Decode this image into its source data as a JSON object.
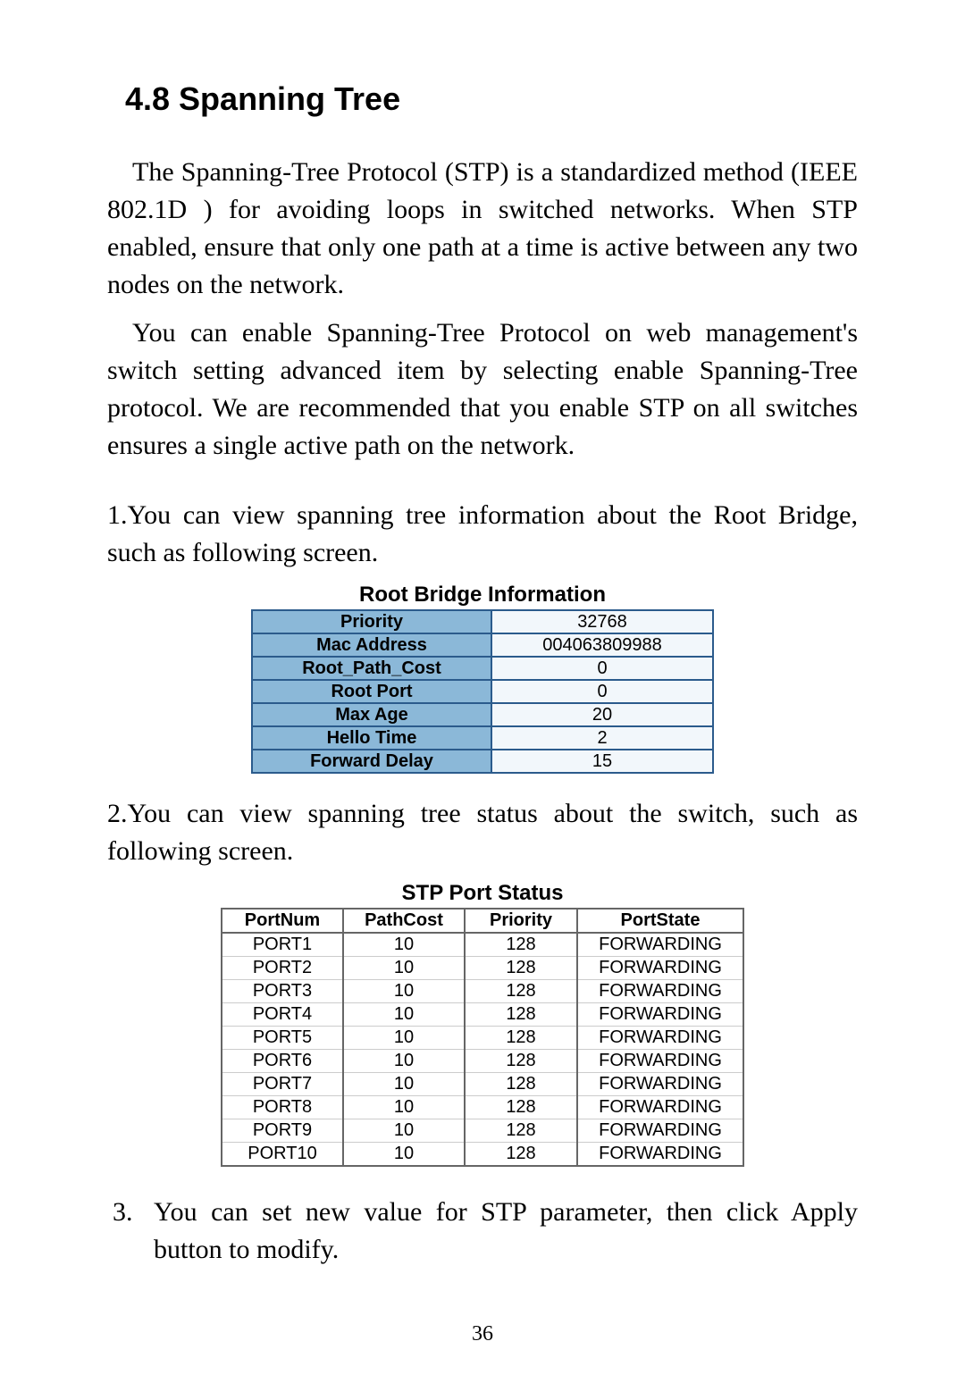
{
  "heading": "4.8 Spanning Tree",
  "para1": "The Spanning-Tree Protocol (STP) is a standardized method (IEEE 802.1D ) for avoiding loops in switched networks. When STP enabled, ensure that only one path at a time is active between any two nodes on the network.",
  "para2": "You can enable Spanning-Tree Protocol on web management's switch setting advanced item by selecting enable Spanning-Tree protocol. We are recommended that you enable STP on all switches ensures a single active path on the network.",
  "step1": "1.You can view spanning tree information about the Root Bridge, such as following screen.",
  "root_caption": "Root Bridge Information",
  "root_rows": [
    {
      "label": "Priority",
      "value": "32768"
    },
    {
      "label": "Mac Address",
      "value": "004063809988"
    },
    {
      "label": "Root_Path_Cost",
      "value": "0"
    },
    {
      "label": "Root Port",
      "value": "0"
    },
    {
      "label": "Max Age",
      "value": "20"
    },
    {
      "label": "Hello Time",
      "value": "2"
    },
    {
      "label": "Forward Delay",
      "value": "15"
    }
  ],
  "step2": "2.You can view spanning tree status about the switch, such as following screen.",
  "port_caption": "STP Port Status",
  "port_headers": {
    "portnum": "PortNum",
    "pathcost": "PathCost",
    "priority": "Priority",
    "portstate": "PortState"
  },
  "port_rows": [
    {
      "portnum": "PORT1",
      "pathcost": "10",
      "priority": "128",
      "portstate": "FORWARDING"
    },
    {
      "portnum": "PORT2",
      "pathcost": "10",
      "priority": "128",
      "portstate": "FORWARDING"
    },
    {
      "portnum": "PORT3",
      "pathcost": "10",
      "priority": "128",
      "portstate": "FORWARDING"
    },
    {
      "portnum": "PORT4",
      "pathcost": "10",
      "priority": "128",
      "portstate": "FORWARDING"
    },
    {
      "portnum": "PORT5",
      "pathcost": "10",
      "priority": "128",
      "portstate": "FORWARDING"
    },
    {
      "portnum": "PORT6",
      "pathcost": "10",
      "priority": "128",
      "portstate": "FORWARDING"
    },
    {
      "portnum": "PORT7",
      "pathcost": "10",
      "priority": "128",
      "portstate": "FORWARDING"
    },
    {
      "portnum": "PORT8",
      "pathcost": "10",
      "priority": "128",
      "portstate": "FORWARDING"
    },
    {
      "portnum": "PORT9",
      "pathcost": "10",
      "priority": "128",
      "portstate": "FORWARDING"
    },
    {
      "portnum": "PORT10",
      "pathcost": "10",
      "priority": "128",
      "portstate": "FORWARDING"
    }
  ],
  "step3_num": "3.",
  "step3_text": "You can set new value for STP parameter, then click Apply button to modify.",
  "page_number": "36"
}
